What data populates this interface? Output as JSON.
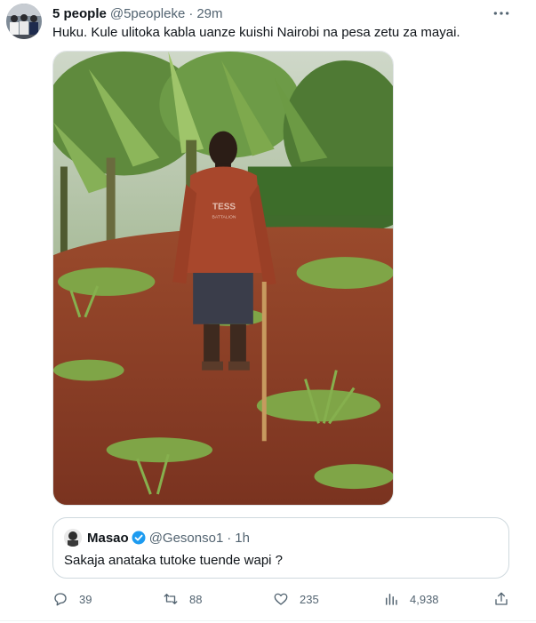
{
  "tweet": {
    "display_name": "5 people",
    "handle": "@5peopleke",
    "separator": "·",
    "time": "29m",
    "text": "Huku. Kule ulitoka kabla uanze kuishi Nairobi na pesa zetu za mayai.",
    "avatar_icon": "group-photo-avatar",
    "more_icon": "more-horizontal-icon",
    "media": {
      "hoodie_text": "TESS",
      "hoodie_subtext": "BATTALION"
    }
  },
  "quote": {
    "display_name": "Masao",
    "handle": "@Gesonso1",
    "separator": "·",
    "time": "1h",
    "text": "Sakaja anataka tutoke tuende wapi ?",
    "verified_color": "#1d9bf0"
  },
  "actions": {
    "replies": "39",
    "retweets": "88",
    "likes": "235",
    "views": "4,938"
  },
  "colors": {
    "text_primary": "#0f1419",
    "text_secondary": "#536471",
    "border": "#cfd9de"
  }
}
